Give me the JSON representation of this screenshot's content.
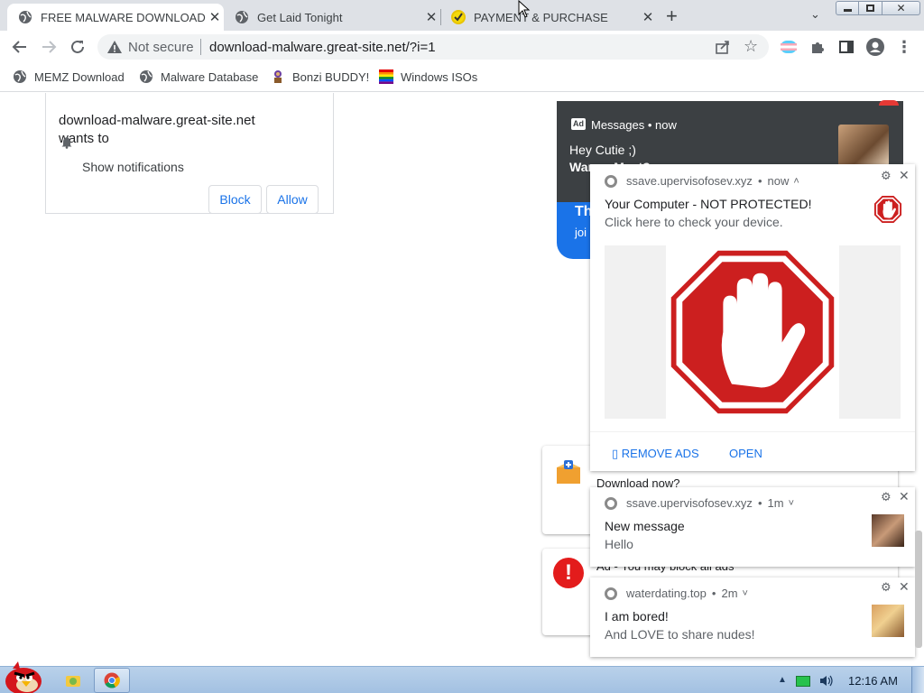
{
  "tabs": [
    {
      "title": "FREE MALWARE DOWNLOAD",
      "active": true
    },
    {
      "title": "Get Laid Tonight",
      "active": false
    },
    {
      "title": "PAYMENT & PURCHASE",
      "active": false
    }
  ],
  "toolbar": {
    "security_label": "Not secure",
    "url": "download-malware.great-site.net/?i=1"
  },
  "bookmarks": [
    {
      "label": "MEMZ Download",
      "icon": "globe-icon"
    },
    {
      "label": "Malware Database",
      "icon": "globe-icon"
    },
    {
      "label": "Bonzi BUDDY!",
      "icon": "bonzi-icon"
    },
    {
      "label": "Windows ISOs",
      "icon": "windows-flag-icon"
    }
  ],
  "permission": {
    "origin": "download-malware.great-site.net",
    "wants_to": "wants to",
    "request": "Show notifications",
    "block_label": "Block",
    "allow_label": "Allow"
  },
  "ad_popup": {
    "badge": "Ad",
    "source": "Messages • now",
    "line1": "Hey Cutie ;)",
    "line2": "Wanna Meet?",
    "blue_title": "Th",
    "blue_sub": "joi"
  },
  "notifications": [
    {
      "origin": "ssave.upervisofosev.xyz",
      "time": "now",
      "chevron": "^",
      "title": "Your Computer - NOT PROTECTED!",
      "body": "Click here to check your device.",
      "actions": [
        "REMOVE ADS",
        "OPEN"
      ]
    },
    {
      "origin": "ssave.upervisofosev.xyz",
      "time": "1m",
      "chevron": "v",
      "title": "New message",
      "body": "Hello"
    },
    {
      "origin": "waterdating.top",
      "time": "2m",
      "chevron": "v",
      "title": "I am bored!",
      "body": "And LOVE to share nudes!"
    }
  ],
  "behind_cards": [
    {
      "text": "Download now?"
    },
    {
      "text": "Ad - You may block all ads"
    }
  ],
  "taskbar": {
    "clock": "12:16 AM"
  },
  "colors": {
    "stop_red": "#cc1f1f",
    "chrome_blue": "#1a73e8",
    "taskbar": "#a9c6e6"
  }
}
